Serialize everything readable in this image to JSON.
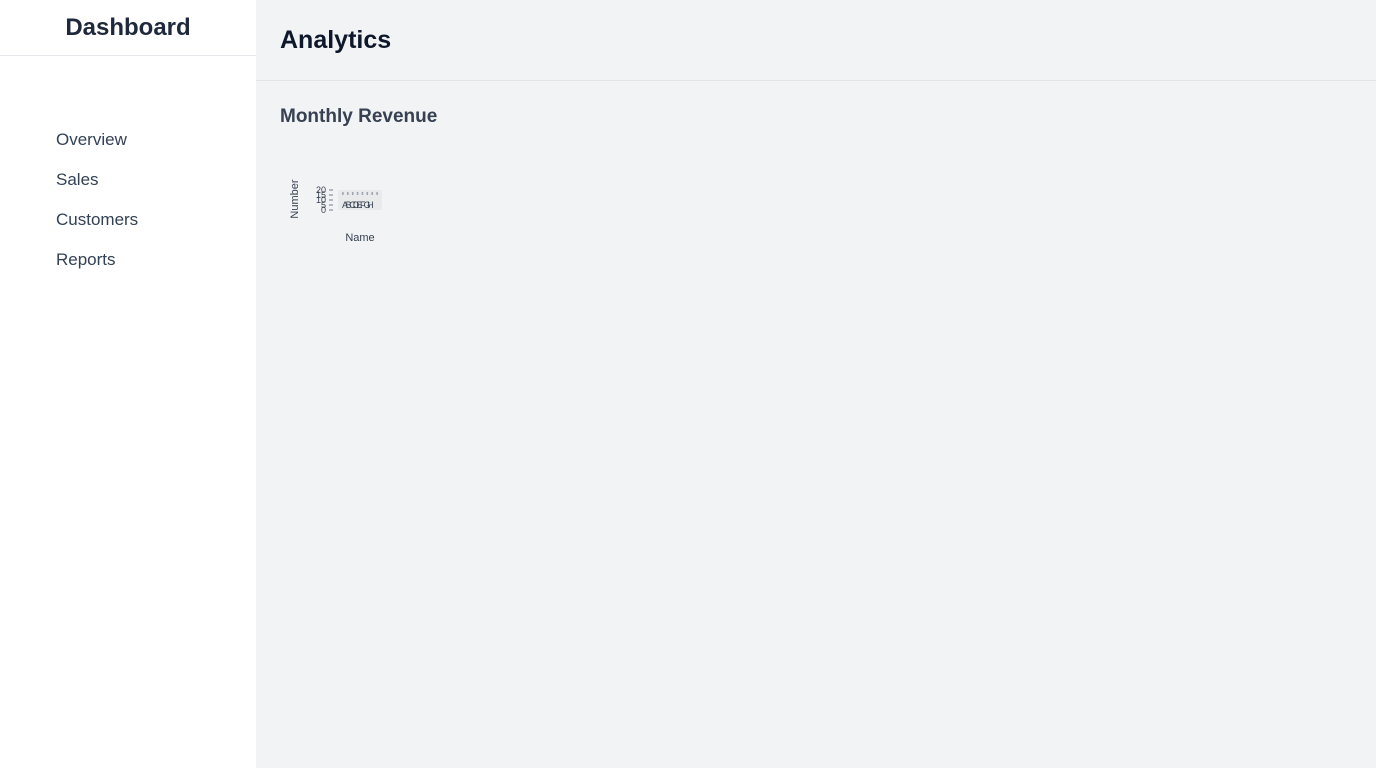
{
  "sidebar": {
    "brand": "Dashboard",
    "items": [
      {
        "label": "Overview"
      },
      {
        "label": "Sales"
      },
      {
        "label": "Customers"
      },
      {
        "label": "Reports"
      }
    ]
  },
  "header": {
    "title": "Analytics"
  },
  "main": {
    "section_title": "Monthly Revenue"
  },
  "chart_data": {
    "type": "bar",
    "categories": [
      "A",
      "B",
      "C",
      "D",
      "E",
      "F",
      "G",
      "H"
    ],
    "values": [
      12,
      19,
      3,
      5,
      2,
      3,
      15,
      8
    ],
    "xlabel": "Name",
    "ylabel": "Number",
    "y_ticks": [
      0,
      5,
      10,
      15,
      20
    ],
    "ylim": [
      0,
      20
    ],
    "grid": true,
    "colors": {
      "bar": "#9ca3af",
      "text": "#374151",
      "grid": "#d1d5db"
    }
  }
}
